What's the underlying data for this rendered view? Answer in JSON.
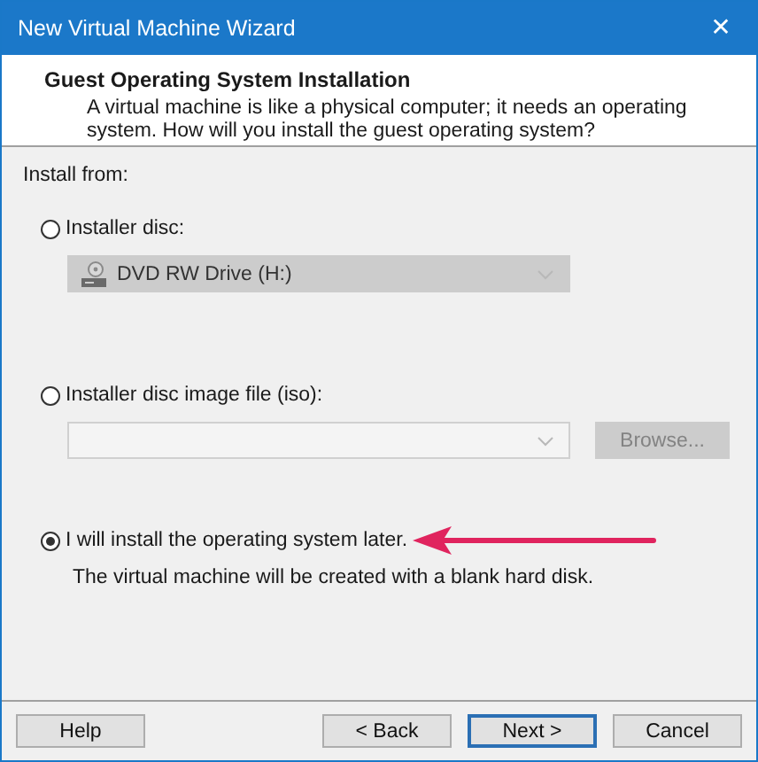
{
  "window": {
    "title": "New Virtual Machine Wizard",
    "close": "✕"
  },
  "header": {
    "title": "Guest Operating System Installation",
    "description": "A virtual machine is like a physical computer; it needs an operating system. How will you install the guest operating system?"
  },
  "install_from": {
    "label": "Install from:",
    "options": [
      {
        "kind": "disc",
        "label": "Installer disc:",
        "selected": false,
        "value": "DVD RW Drive (H:)",
        "disabled": true
      },
      {
        "kind": "iso",
        "label": "Installer disc image file (iso):",
        "selected": false,
        "browse": "Browse...",
        "disabled": true
      },
      {
        "kind": "later",
        "label": "I will install the operating system later.",
        "selected": true,
        "note": "The virtual machine will be created with a blank hard disk."
      }
    ]
  },
  "buttons": [
    {
      "label": "Help",
      "default": false
    },
    {
      "label": "< Back",
      "default": false
    },
    {
      "label": "Next >",
      "default": true
    },
    {
      "label": "Cancel",
      "default": false
    }
  ]
}
